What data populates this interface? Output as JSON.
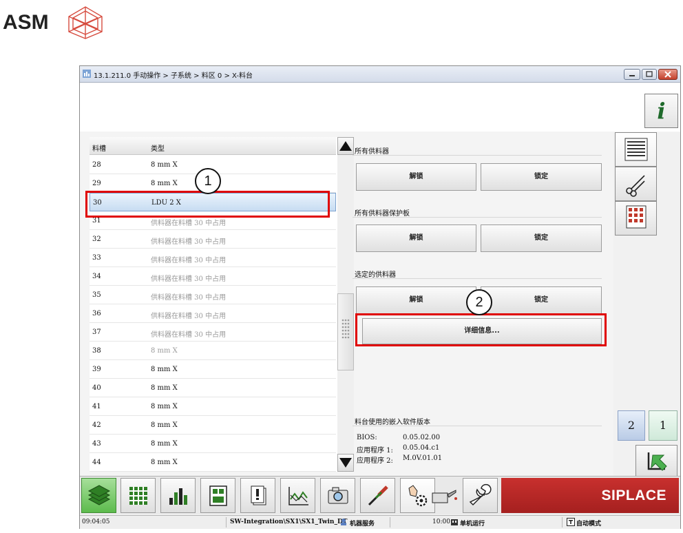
{
  "logo": {
    "text": "ASM"
  },
  "window": {
    "title": "13.1.211.0 手动操作 > 子系统 > 料区 0 > X-料台",
    "info_label": "i"
  },
  "table": {
    "headers": [
      "料槽",
      "类型"
    ],
    "rows": [
      {
        "slot": "28",
        "type": "8 mm X",
        "dim": false
      },
      {
        "slot": "29",
        "type": "8 mm X",
        "dim": false
      },
      {
        "slot": "30",
        "type": "LDU 2 X",
        "dim": false,
        "selected": true
      },
      {
        "slot": "31",
        "type": "供料器在料槽 30 中占用",
        "dim": true
      },
      {
        "slot": "32",
        "type": "供料器在料槽 30 中占用",
        "dim": true
      },
      {
        "slot": "33",
        "type": "供料器在料槽 30 中占用",
        "dim": true
      },
      {
        "slot": "34",
        "type": "供料器在料槽 30 中占用",
        "dim": true
      },
      {
        "slot": "35",
        "type": "供料器在料槽 30 中占用",
        "dim": true
      },
      {
        "slot": "36",
        "type": "供料器在料槽 30 中占用",
        "dim": true
      },
      {
        "slot": "37",
        "type": "供料器在料槽 30 中占用",
        "dim": true
      },
      {
        "slot": "38",
        "type": "8 mm X",
        "dim": true
      },
      {
        "slot": "39",
        "type": "8 mm X",
        "dim": false
      },
      {
        "slot": "40",
        "type": "8 mm X",
        "dim": false
      },
      {
        "slot": "41",
        "type": "8 mm X",
        "dim": false
      },
      {
        "slot": "42",
        "type": "8 mm X",
        "dim": false
      },
      {
        "slot": "43",
        "type": "8 mm X",
        "dim": false
      },
      {
        "slot": "44",
        "type": "8 mm X",
        "dim": false
      }
    ]
  },
  "panel": {
    "all_feeders": {
      "label": "所有供料器",
      "unlock": "解锁",
      "lock": "锁定"
    },
    "all_covers": {
      "label": "所有供料器保护板",
      "unlock": "解锁",
      "lock": "锁定"
    },
    "selected": {
      "label": "选定的供料器",
      "unlock": "解锁",
      "lock": "锁定",
      "details": "详细信息..."
    },
    "firmware": {
      "label": "料台使用的嵌入软件版本",
      "bios_label": "BIOS:",
      "bios_value": "0.05.02.00",
      "app1_label": "应用程序 1:",
      "app1_value": "0.05.04.c1",
      "app2_label": "应用程序 2:",
      "app2_value": "M.0V.01.01"
    }
  },
  "sidebar": {
    "page_2": "2",
    "page_1": "1"
  },
  "brand": "SIPLACE",
  "status": {
    "time": "09:04:05",
    "path": "SW-Integration\\SX1\\SX1_Twin_DT",
    "service": "机器服务",
    "clock": "10:00",
    "mode1": "单机运行",
    "mode2": "自动模式"
  },
  "callouts": [
    "1",
    "2"
  ],
  "colors": {
    "highlight": "#e00000",
    "brand": "#b52524",
    "active_tool": "#5dbb4d"
  }
}
